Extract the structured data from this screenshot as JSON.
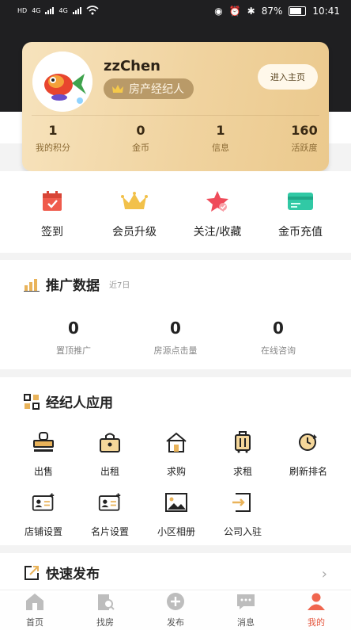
{
  "status_bar": {
    "network_left": [
      "HD",
      "4G",
      "HD",
      "4G"
    ],
    "battery": "87%",
    "time": "10:41"
  },
  "profile": {
    "username": "zzChen",
    "role": "房产经纪人",
    "enter_label": "进入主页"
  },
  "stats": [
    {
      "value": "1",
      "label": "我的积分"
    },
    {
      "value": "0",
      "label": "金币"
    },
    {
      "value": "1",
      "label": "信息"
    },
    {
      "value": "160",
      "label": "活跃度"
    }
  ],
  "quick_actions": [
    {
      "label": "签到",
      "icon": "calendar-check-icon"
    },
    {
      "label": "会员升级",
      "icon": "crown-icon"
    },
    {
      "label": "关注/收藏",
      "icon": "star-icon"
    },
    {
      "label": "金币充值",
      "icon": "card-icon"
    }
  ],
  "promotion": {
    "title": "推广数据",
    "subtitle": "近7日",
    "items": [
      {
        "value": "0",
        "label": "置顶推广"
      },
      {
        "value": "0",
        "label": "房源点击量"
      },
      {
        "value": "0",
        "label": "在线咨询"
      }
    ]
  },
  "agent_apps": {
    "title": "经纪人应用",
    "items": [
      {
        "label": "出售",
        "icon": "stamp-icon"
      },
      {
        "label": "出租",
        "icon": "rent-lock-icon"
      },
      {
        "label": "求购",
        "icon": "house-icon"
      },
      {
        "label": "求租",
        "icon": "luggage-icon"
      },
      {
        "label": "刷新排名",
        "icon": "refresh-icon"
      },
      {
        "label": "店铺设置",
        "icon": "id-card-add-icon"
      },
      {
        "label": "名片设置",
        "icon": "business-card-icon"
      },
      {
        "label": "小区相册",
        "icon": "photo-icon"
      },
      {
        "label": "公司入驻",
        "icon": "company-join-icon"
      }
    ]
  },
  "quick_publish": {
    "title": "快速发布"
  },
  "tabs": [
    {
      "label": "首页",
      "icon": "home-icon"
    },
    {
      "label": "找房",
      "icon": "find-house-icon"
    },
    {
      "label": "发布",
      "icon": "plus-circle-icon"
    },
    {
      "label": "消息",
      "icon": "message-icon"
    },
    {
      "label": "我的",
      "icon": "profile-icon",
      "active": true
    }
  ],
  "colors": {
    "accent": "#e5573f",
    "gold": "#f0d39f",
    "dark": "#1f1f21"
  }
}
